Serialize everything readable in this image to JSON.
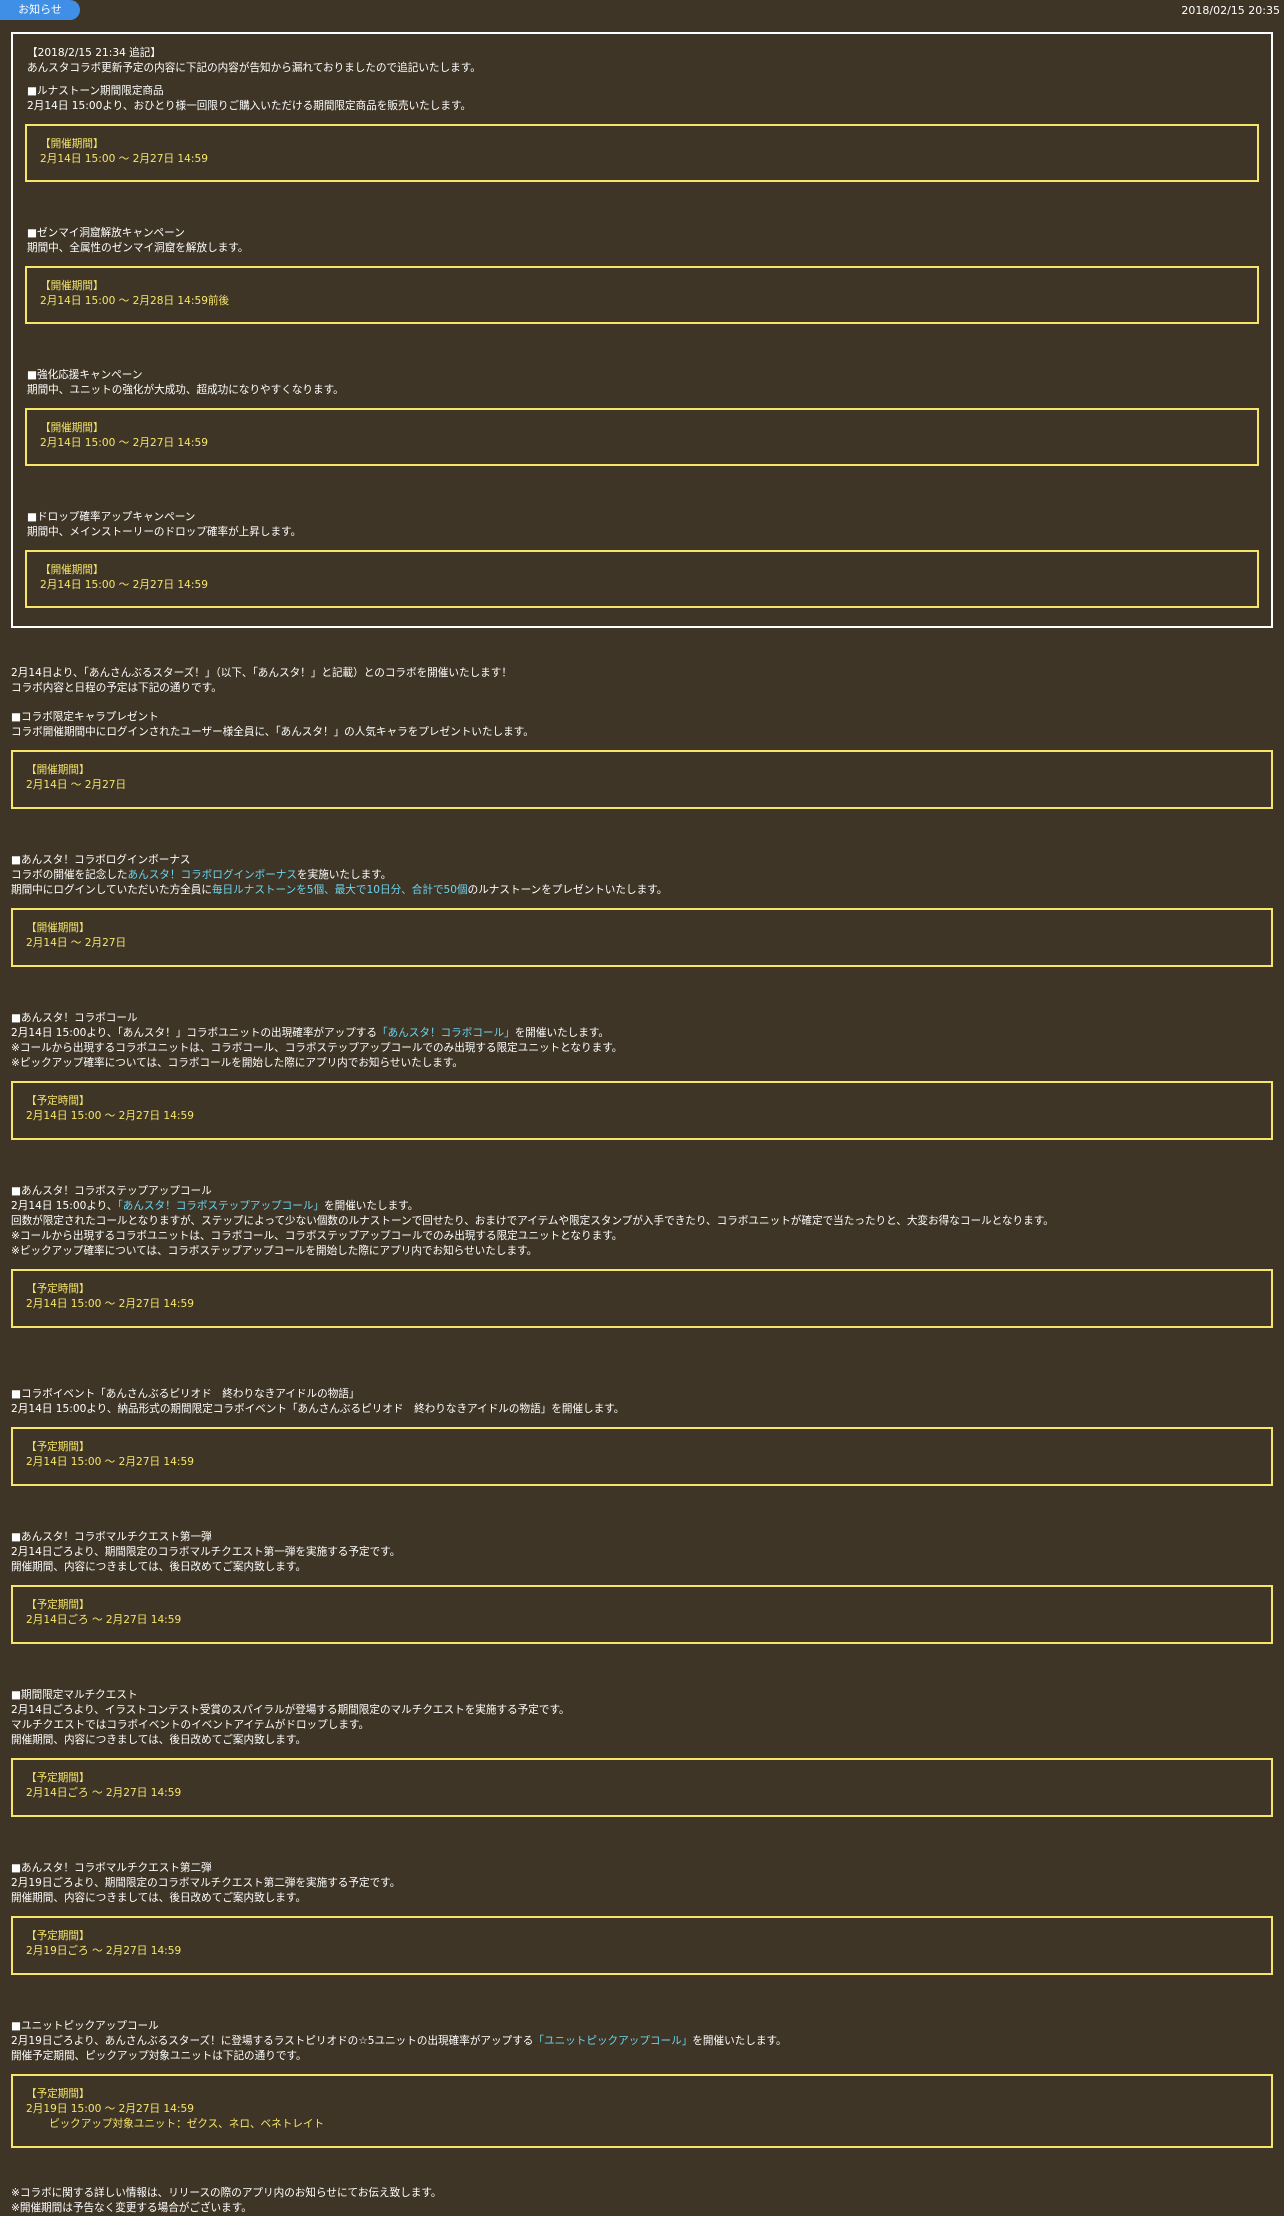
{
  "header": {
    "badge": "お知らせ",
    "date": "2018/02/15 20:35"
  },
  "addendum": {
    "title": "【2018/2/15 21:34 追記】",
    "intro": "あんスタコラボ更新予定の内容に下記の内容が告知から漏れておりましたので追記いたします。",
    "sections": [
      {
        "heading": "■ルナストーン期間限定商品",
        "desc": "2月14日 15:00より、おひとり様一回限りご購入いただける期間限定商品を販売いたします。",
        "box_label": "【開催期間】",
        "box_value": "2月14日 15:00 ～ 2月27日 14:59"
      },
      {
        "heading": "■ゼンマイ洞窟解放キャンペーン",
        "desc": "期間中、全属性のゼンマイ洞窟を解放します。",
        "box_label": "【開催期間】",
        "box_value": "2月14日 15:00 ～ 2月28日 14:59前後"
      },
      {
        "heading": "■強化応援キャンペーン",
        "desc": "期間中、ユニットの強化が大成功、超成功になりやすくなります。",
        "box_label": "【開催期間】",
        "box_value": "2月14日 15:00 ～ 2月27日 14:59"
      },
      {
        "heading": "■ドロップ確率アップキャンペーン",
        "desc": "期間中、メインストーリーのドロップ確率が上昇します。",
        "box_label": "【開催期間】",
        "box_value": "2月14日 15:00 ～ 2月27日 14:59"
      }
    ]
  },
  "intro": {
    "line1": "2月14日より、「あんさんぶるスターズ！」（以下、「あんスタ！」と記載）とのコラボを開催いたします！",
    "line2": "コラボ内容と日程の予定は下記の通りです。"
  },
  "present": {
    "heading": "■コラボ限定キャラプレゼント",
    "desc": "コラボ開催期間中にログインされたユーザー様全員に、「あんスタ！」の人気キャラをプレゼントいたします。",
    "box_label": "【開催期間】",
    "box_value": "2月14日 ～ 2月27日"
  },
  "login_bonus": {
    "heading": "■あんスタ！コラボログインボーナス",
    "l1_pre": "コラボの開催を記念した",
    "l1_link": "あんスタ！コラボログインボーナス",
    "l1_post": "を実施いたします。",
    "l2_pre": "期間中にログインしていただいた方全員に",
    "l2_hl": "毎日ルナストーンを5個、最大で10日分、合計で50個",
    "l2_post": "のルナストーンをプレゼントいたします。",
    "box_label": "【開催期間】",
    "box_value": "2月14日 ～ 2月27日"
  },
  "collab_call": {
    "heading": "■あんスタ！コラボコール",
    "l1_pre": "2月14日 15:00より、「あんスタ！」コラボユニットの出現確率がアップする",
    "l1_link": "「あんスタ！コラボコール」",
    "l1_post": "を開催いたします。",
    "l2": "※コールから出現するコラボユニットは、コラボコール、コラボステップアップコールでのみ出現する限定ユニットとなります。",
    "l3": "※ピックアップ確率については、コラボコールを開始した際にアプリ内でお知らせいたします。",
    "box_label": "【予定時間】",
    "box_value": "2月14日 15:00 ～ 2月27日 14:59"
  },
  "step_call": {
    "heading": "■あんスタ！コラボステップアップコール",
    "l1_pre": "2月14日 15:00より、",
    "l1_link": "「あんスタ！コラボステップアップコール」",
    "l1_post": "を開催いたします。",
    "l2": "回数が限定されたコールとなりますが、ステップによって少ない個数のルナストーンで回せたり、おまけでアイテムや限定スタンプが入手できたり、コラボユニットが確定で当たったりと、大変お得なコールとなります。",
    "l3": "※コールから出現するコラボユニットは、コラボコール、コラボステップアップコールでのみ出現する限定ユニットとなります。",
    "l4": "※ピックアップ確率については、コラボステップアップコールを開始した際にアプリ内でお知らせいたします。",
    "box_label": "【予定時間】",
    "box_value": "2月14日 15:00 ～ 2月27日 14:59"
  },
  "collab_event": {
    "heading": "■コラボイベント「あんさんぶるピリオド　終わりなきアイドルの物語」",
    "l1": "2月14日 15:00より、納品形式の期間限定コラボイベント「あんさんぶるピリオド　終わりなきアイドルの物語」を開催します。",
    "box_label": "【予定期間】",
    "box_value": "2月14日 15:00 ～ 2月27日 14:59"
  },
  "multi1": {
    "heading": "■あんスタ！コラボマルチクエスト第一弾",
    "l1": "2月14日ごろより、期間限定のコラボマルチクエスト第一弾を実施する予定です。",
    "l2": "開催期間、内容につきましては、後日改めてご案内致します。",
    "box_label": "【予定期間】",
    "box_value": "2月14日ごろ ～ 2月27日 14:59"
  },
  "limited_multi": {
    "heading": "■期間限定マルチクエスト",
    "l1": "2月14日ごろより、イラストコンテスト受賞のスパイラルが登場する期間限定のマルチクエストを実施する予定です。",
    "l2": "マルチクエストではコラボイベントのイベントアイテムがドロップします。",
    "l3": "開催期間、内容につきましては、後日改めてご案内致します。",
    "box_label": "【予定期間】",
    "box_value": "2月14日ごろ ～ 2月27日 14:59"
  },
  "multi2": {
    "heading": "■あんスタ！コラボマルチクエスト第二弾",
    "l1": "2月19日ごろより、期間限定のコラボマルチクエスト第二弾を実施する予定です。",
    "l2": "開催期間、内容につきましては、後日改めてご案内致します。",
    "box_label": "【予定期間】",
    "box_value": "2月19日ごろ ～ 2月27日 14:59"
  },
  "pickup": {
    "heading": "■ユニットピックアップコール",
    "l1_pre": "2月19日ごろより、あんさんぶるスターズ！に登場するラストピリオドの☆5ユニットの出現確率がアップする",
    "l1_link": "「ユニットピックアップコール」",
    "l1_post": "を開催いたします。",
    "l2": "開催予定期間、ピックアップ対象ユニットは下記の通りです。",
    "box_label": "【予定期間】",
    "box_value": "2月19日 15:00 ～ 2月27日 14:59",
    "box_units": "ピックアップ対象ユニット：ゼクス、ネロ、ベネトレイト"
  },
  "footer": {
    "l1": "※コラボに関する詳しい情報は、リリースの際のアプリ内のお知らせにてお伝え致します。",
    "l2": "※開催期間は予告なく変更する場合がございます。"
  },
  "colors": {
    "background": "#3e3526",
    "badge": "#3f8fe6",
    "period_box": "#f7e56a",
    "link": "#6ad6f2"
  }
}
